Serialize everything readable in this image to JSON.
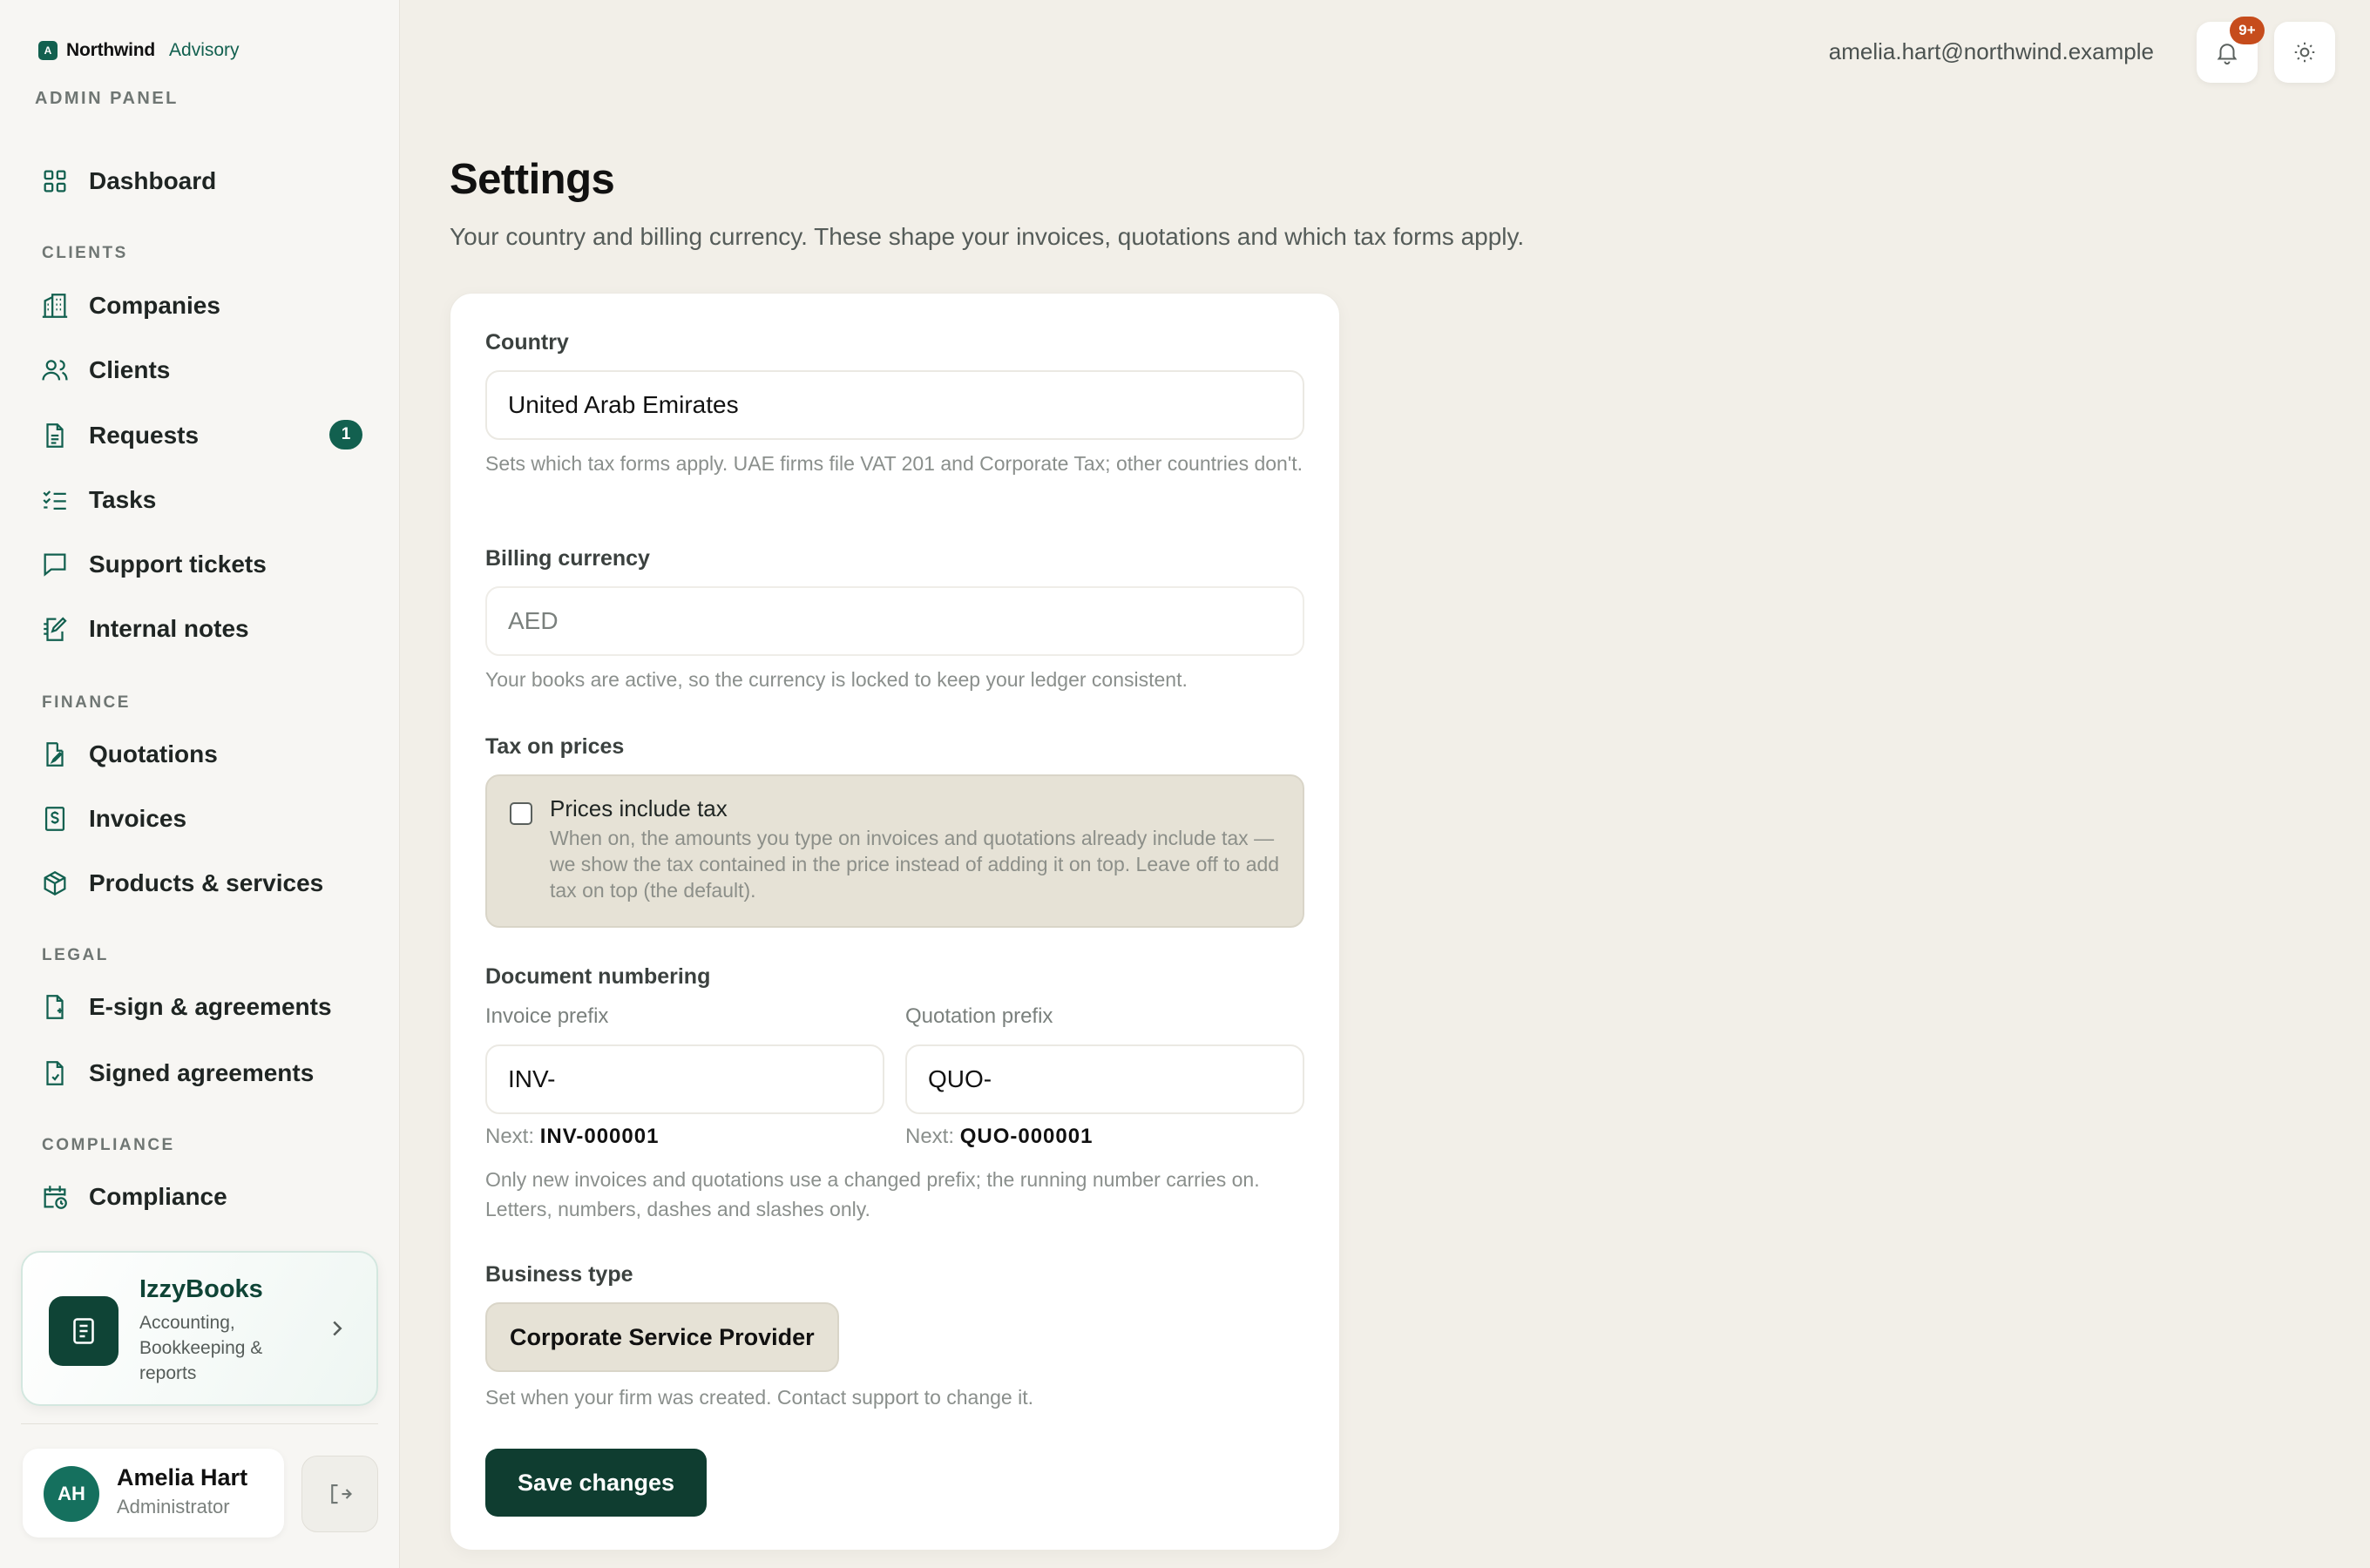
{
  "brand": {
    "name": "Northwind",
    "sub": "Advisory",
    "logo_letter": "A",
    "panel_label": "ADMIN PANEL"
  },
  "nav": {
    "dashboard": "Dashboard",
    "sections": {
      "clients": "CLIENTS",
      "finance": "FINANCE",
      "legal": "LEGAL",
      "compliance": "COMPLIANCE"
    },
    "items": {
      "companies": "Companies",
      "clients": "Clients",
      "requests": "Requests",
      "requests_badge": "1",
      "tasks": "Tasks",
      "support_tickets": "Support tickets",
      "internal_notes": "Internal notes",
      "quotations": "Quotations",
      "invoices": "Invoices",
      "products_services": "Products & services",
      "esign": "E-sign & agreements",
      "signed_agreements": "Signed agreements",
      "compliance": "Compliance"
    }
  },
  "izzybooks": {
    "title": "IzzyBooks",
    "description": "Accounting, Bookkeeping & reports"
  },
  "user": {
    "initials": "AH",
    "name": "Amelia Hart",
    "role": "Administrator",
    "email": "amelia.hart@northwind.example"
  },
  "topbar": {
    "notification_count": "9+"
  },
  "page": {
    "title": "Settings",
    "subtitle": "Your country and billing currency. These shape your invoices, quotations and which tax forms apply."
  },
  "form": {
    "country": {
      "label": "Country",
      "value": "United Arab Emirates",
      "hint": "Sets which tax forms apply. UAE firms file VAT 201 and Corporate Tax; other countries don't."
    },
    "currency": {
      "label": "Billing currency",
      "value": "AED",
      "hint": "Your books are active, so the currency is locked to keep your ledger consistent."
    },
    "tax": {
      "label": "Tax on prices",
      "checkbox_label": "Prices include tax",
      "checked": false,
      "description": "When on, the amounts you type on invoices and quotations already include tax — we show the tax contained in the price instead of adding it on top. Leave off to add tax on top (the default)."
    },
    "numbering": {
      "label": "Document numbering",
      "invoice_prefix_label": "Invoice prefix",
      "invoice_prefix": "INV-",
      "invoice_next_label": "Next:",
      "invoice_next": "INV-000001",
      "quotation_prefix_label": "Quotation prefix",
      "quotation_prefix": "QUO-",
      "quotation_next_label": "Next:",
      "quotation_next": "QUO-000001",
      "hint": "Only new invoices and quotations use a changed prefix; the running number carries on. Letters, numbers, dashes and slashes only."
    },
    "business_type": {
      "label": "Business type",
      "value": "Corporate Service Provider",
      "hint": "Set when your firm was created. Contact support to change it."
    },
    "save_label": "Save changes"
  },
  "colors": {
    "accent": "#12604f",
    "primary_button": "#0f3d30",
    "badge_orange": "#c64c1c",
    "background": "#f2efe8"
  }
}
